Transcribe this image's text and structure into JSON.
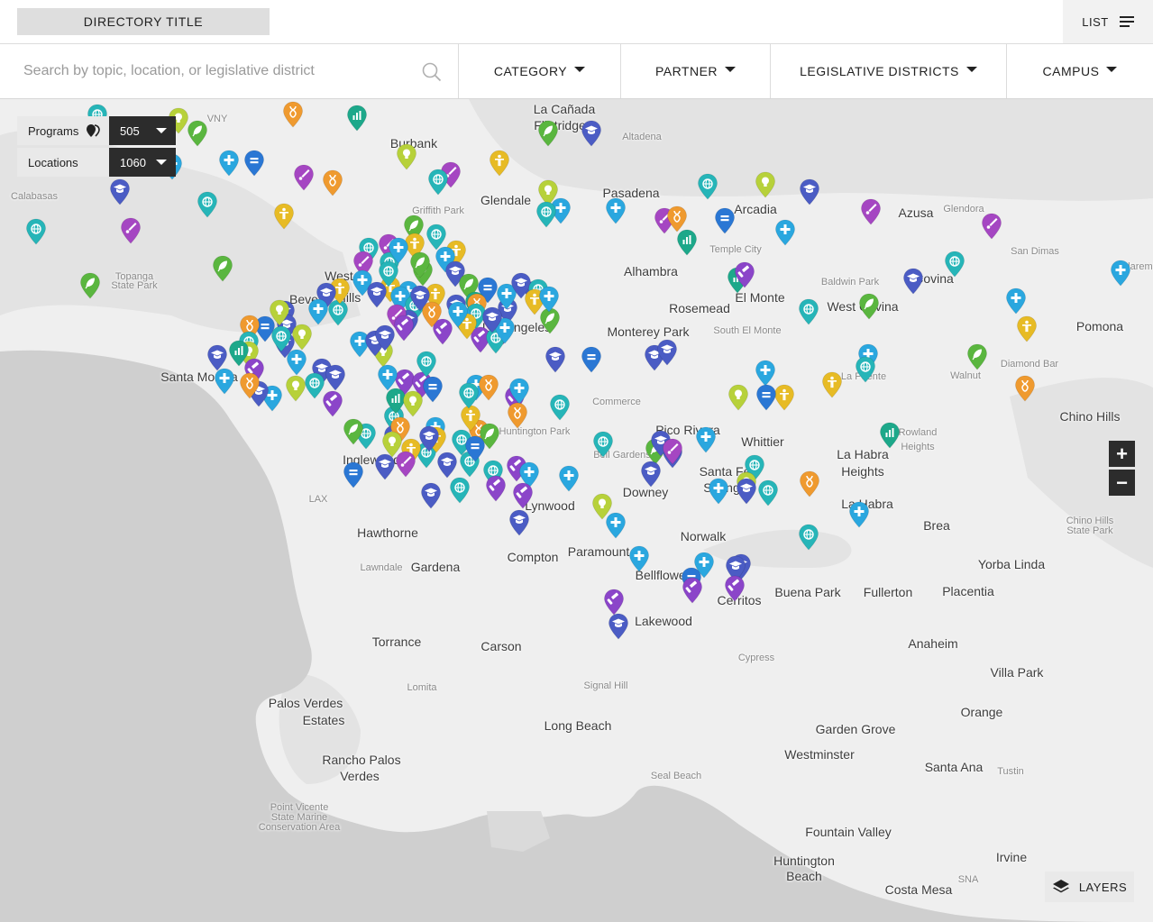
{
  "header": {
    "directory_title": "DIRECTORY TITLE",
    "list_label": "LIST"
  },
  "search": {
    "placeholder": "Search by topic, location, or legislative district"
  },
  "filters": [
    {
      "label": "CATEGORY"
    },
    {
      "label": "PARTNER"
    },
    {
      "label": "LEGISLATIVE DISTRICTS"
    },
    {
      "label": "CAMPUS"
    }
  ],
  "counters": {
    "programs": {
      "label": "Programs",
      "value": "505"
    },
    "locations": {
      "label": "Locations",
      "value": "1060"
    }
  },
  "map_controls": {
    "zoom_in": "+",
    "zoom_out": "−",
    "layers_label": "LAYERS"
  },
  "colors": {
    "water": "#cfcfcf",
    "land": "#efefef",
    "hills": "#e3e3e3",
    "dark_control": "#2c2c2c",
    "categories": {
      "health": "#2aa7df",
      "education": "#4b5cc4",
      "law": "#8b45c9",
      "arts": "#a546c2",
      "science": "#ef9a2f",
      "community": "#e7bb25",
      "ideas": "#b7d13a",
      "environment": "#5ab63f",
      "global": "#26b5b8",
      "data": "#1da88a",
      "government": "#2a77d4"
    }
  },
  "category_icons": {
    "health": "plus-icon",
    "education": "graduation-cap-icon",
    "law": "gavel-icon",
    "arts": "brush-icon",
    "science": "dna-icon",
    "community": "person-icon",
    "ideas": "lightbulb-icon",
    "environment": "leaf-icon",
    "global": "globe-icon",
    "data": "bar-chart-icon",
    "government": "equals-icon"
  },
  "place_labels": [
    {
      "text": "La Cañada",
      "cls": ""
    },
    {
      "text": "Flintridge",
      "cls": ""
    },
    {
      "text": "Altadena",
      "cls": "small"
    },
    {
      "text": "Burbank",
      "cls": ""
    },
    {
      "text": "VNY",
      "cls": "small"
    },
    {
      "text": "Glendale",
      "cls": ""
    },
    {
      "text": "Griffith Park",
      "cls": "small"
    },
    {
      "text": "Pasadena",
      "cls": ""
    },
    {
      "text": "Arcadia",
      "cls": ""
    },
    {
      "text": "Azusa",
      "cls": ""
    },
    {
      "text": "Glendora",
      "cls": "small"
    },
    {
      "text": "Calabasas",
      "cls": "small"
    },
    {
      "text": "San Dimas",
      "cls": "small"
    },
    {
      "text": "Temple City",
      "cls": "small"
    },
    {
      "text": "Topanga",
      "cls": "small"
    },
    {
      "text": "State Park",
      "cls": "small"
    },
    {
      "text": "Alhambra",
      "cls": ""
    },
    {
      "text": "Baldwin Park",
      "cls": "small"
    },
    {
      "text": "Covina",
      "cls": ""
    },
    {
      "text": "Claremo",
      "cls": "small"
    },
    {
      "text": "West",
      "cls": ""
    },
    {
      "text": "Hills",
      "cls": ""
    },
    {
      "text": "Beve",
      "cls": ""
    },
    {
      "text": "Rosemead",
      "cls": ""
    },
    {
      "text": "El Monte",
      "cls": ""
    },
    {
      "text": "West Covina",
      "cls": ""
    },
    {
      "text": "Pomona",
      "cls": ""
    },
    {
      "text": "Los Angeles",
      "cls": ""
    },
    {
      "text": "Monterey Park",
      "cls": ""
    },
    {
      "text": "South El Monte",
      "cls": "small"
    },
    {
      "text": "Diamond Bar",
      "cls": "small"
    },
    {
      "text": "Walnut",
      "cls": "small"
    },
    {
      "text": "Santa Monica",
      "cls": ""
    },
    {
      "text": "La Puente",
      "cls": "small"
    },
    {
      "text": "Chino Hills",
      "cls": ""
    },
    {
      "text": "Commerce",
      "cls": "small"
    },
    {
      "text": "Rowland",
      "cls": "small"
    },
    {
      "text": "Heights",
      "cls": "small"
    },
    {
      "text": "Huntington Park",
      "cls": "small"
    },
    {
      "text": "Pico Rivera",
      "cls": ""
    },
    {
      "text": "Whittier",
      "cls": ""
    },
    {
      "text": "La Habra",
      "cls": ""
    },
    {
      "text": "Heights",
      "cls": ""
    },
    {
      "text": "Inglewood",
      "cls": ""
    },
    {
      "text": "Bell Gardens",
      "cls": "small"
    },
    {
      "text": "Santa Fe",
      "cls": ""
    },
    {
      "text": "Springs",
      "cls": ""
    },
    {
      "text": "LAX",
      "cls": "small"
    },
    {
      "text": "Downey",
      "cls": ""
    },
    {
      "text": "La Habra",
      "cls": ""
    },
    {
      "text": "Lynwood",
      "cls": ""
    },
    {
      "text": "Hawthorne",
      "cls": ""
    },
    {
      "text": "Brea",
      "cls": ""
    },
    {
      "text": "Norwalk",
      "cls": ""
    },
    {
      "text": "Chino Hills",
      "cls": "small"
    },
    {
      "text": "State Park",
      "cls": "small"
    },
    {
      "text": "Paramount",
      "cls": ""
    },
    {
      "text": "Compton",
      "cls": ""
    },
    {
      "text": "Lawndale",
      "cls": "small"
    },
    {
      "text": "Gardena",
      "cls": ""
    },
    {
      "text": "Yorba Linda",
      "cls": ""
    },
    {
      "text": "Bellflower",
      "cls": ""
    },
    {
      "text": "Buena Park",
      "cls": ""
    },
    {
      "text": "Fullerton",
      "cls": ""
    },
    {
      "text": "Placentia",
      "cls": ""
    },
    {
      "text": "Cerritos",
      "cls": ""
    },
    {
      "text": "Lakewood",
      "cls": ""
    },
    {
      "text": "Anaheim",
      "cls": ""
    },
    {
      "text": "Torrance",
      "cls": ""
    },
    {
      "text": "Carson",
      "cls": ""
    },
    {
      "text": "Cypress",
      "cls": "small"
    },
    {
      "text": "Villa Park",
      "cls": ""
    },
    {
      "text": "Lomita",
      "cls": "small"
    },
    {
      "text": "Signal Hill",
      "cls": "small"
    },
    {
      "text": "Palos Verdes",
      "cls": ""
    },
    {
      "text": "Estates",
      "cls": ""
    },
    {
      "text": "Orange",
      "cls": ""
    },
    {
      "text": "Long Beach",
      "cls": ""
    },
    {
      "text": "Garden Grove",
      "cls": ""
    },
    {
      "text": "Westminster",
      "cls": ""
    },
    {
      "text": "Rancho Palos",
      "cls": ""
    },
    {
      "text": "Verdes",
      "cls": ""
    },
    {
      "text": "Santa Ana",
      "cls": ""
    },
    {
      "text": "Tustin",
      "cls": "small"
    },
    {
      "text": "Seal Beach",
      "cls": "small"
    },
    {
      "text": "Point Vicente",
      "cls": "small"
    },
    {
      "text": "State Marine",
      "cls": "small"
    },
    {
      "text": "Conservation Area",
      "cls": "small"
    },
    {
      "text": "Fountain Valley",
      "cls": ""
    },
    {
      "text": "Huntington",
      "cls": ""
    },
    {
      "text": "Beach",
      "cls": ""
    },
    {
      "text": "Irvine",
      "cls": ""
    },
    {
      "text": "SNA",
      "cls": "small"
    },
    {
      "text": "Costa Mesa",
      "cls": ""
    }
  ],
  "markers": [
    {
      "cat": "global"
    },
    {
      "cat": "ideas"
    },
    {
      "cat": "environment"
    },
    {
      "cat": "science"
    },
    {
      "cat": "data"
    },
    {
      "cat": "environment"
    },
    {
      "cat": "education"
    },
    {
      "cat": "health"
    },
    {
      "cat": "government"
    },
    {
      "cat": "health"
    },
    {
      "cat": "arts"
    },
    {
      "cat": "science"
    },
    {
      "cat": "ideas"
    },
    {
      "cat": "community"
    },
    {
      "cat": "arts"
    },
    {
      "cat": "global"
    },
    {
      "cat": "education"
    },
    {
      "cat": "global"
    },
    {
      "cat": "ideas"
    },
    {
      "cat": "health"
    },
    {
      "cat": "health"
    },
    {
      "cat": "global"
    },
    {
      "cat": "arts"
    },
    {
      "cat": "science"
    },
    {
      "cat": "government"
    },
    {
      "cat": "data"
    },
    {
      "cat": "ideas"
    },
    {
      "cat": "arts"
    },
    {
      "cat": "global"
    },
    {
      "cat": "arts"
    },
    {
      "cat": "education"
    },
    {
      "cat": "global"
    },
    {
      "cat": "environment"
    },
    {
      "cat": "arts"
    },
    {
      "cat": "environment"
    },
    {
      "cat": "environment"
    },
    {
      "cat": "community"
    },
    {
      "cat": "environment"
    },
    {
      "cat": "global"
    },
    {
      "cat": "community"
    },
    {
      "cat": "global"
    },
    {
      "cat": "arts"
    },
    {
      "cat": "community"
    },
    {
      "cat": "health"
    },
    {
      "cat": "global"
    },
    {
      "cat": "arts"
    },
    {
      "cat": "health"
    },
    {
      "cat": "environment"
    },
    {
      "cat": "education"
    },
    {
      "cat": "community"
    },
    {
      "cat": "health"
    },
    {
      "cat": "education"
    },
    {
      "cat": "environment"
    },
    {
      "cat": "community"
    },
    {
      "cat": "global"
    },
    {
      "cat": "health"
    },
    {
      "cat": "global"
    },
    {
      "cat": "education"
    },
    {
      "cat": "health"
    },
    {
      "cat": "global"
    },
    {
      "cat": "education"
    },
    {
      "cat": "community"
    },
    {
      "cat": "arts"
    },
    {
      "cat": "law"
    },
    {
      "cat": "education"
    },
    {
      "cat": "education"
    },
    {
      "cat": "government"
    },
    {
      "cat": "education"
    },
    {
      "cat": "education"
    },
    {
      "cat": "global"
    },
    {
      "cat": "ideas"
    },
    {
      "cat": "science"
    },
    {
      "cat": "ideas"
    },
    {
      "cat": "global"
    },
    {
      "cat": "health"
    },
    {
      "cat": "health"
    },
    {
      "cat": "education"
    },
    {
      "cat": "ideas"
    },
    {
      "cat": "data"
    },
    {
      "cat": "education"
    },
    {
      "cat": "law"
    },
    {
      "cat": "global"
    },
    {
      "cat": "health"
    },
    {
      "cat": "education"
    },
    {
      "cat": "health"
    },
    {
      "cat": "education"
    },
    {
      "cat": "ideas"
    },
    {
      "cat": "science"
    },
    {
      "cat": "law"
    },
    {
      "cat": "health"
    },
    {
      "cat": "ideas"
    },
    {
      "cat": "education"
    },
    {
      "cat": "education"
    },
    {
      "cat": "government"
    },
    {
      "cat": "health"
    },
    {
      "cat": "law"
    },
    {
      "cat": "education"
    },
    {
      "cat": "data"
    },
    {
      "cat": "education"
    },
    {
      "cat": "global"
    },
    {
      "cat": "environment"
    },
    {
      "cat": "community"
    },
    {
      "cat": "science"
    },
    {
      "cat": "global"
    },
    {
      "cat": "education"
    },
    {
      "cat": "health"
    },
    {
      "cat": "law"
    },
    {
      "cat": "arts"
    },
    {
      "cat": "global"
    },
    {
      "cat": "community"
    },
    {
      "cat": "health"
    },
    {
      "cat": "science"
    },
    {
      "cat": "education"
    },
    {
      "cat": "law"
    },
    {
      "cat": "law"
    },
    {
      "cat": "law"
    },
    {
      "cat": "government"
    },
    {
      "cat": "global"
    },
    {
      "cat": "global"
    },
    {
      "cat": "global"
    },
    {
      "cat": "global"
    },
    {
      "cat": "community"
    },
    {
      "cat": "arts"
    },
    {
      "cat": "education"
    },
    {
      "cat": "health"
    },
    {
      "cat": "science"
    },
    {
      "cat": "global"
    },
    {
      "cat": "community"
    },
    {
      "cat": "law"
    },
    {
      "cat": "health"
    },
    {
      "cat": "global"
    },
    {
      "cat": "science"
    },
    {
      "cat": "health"
    },
    {
      "cat": "science"
    },
    {
      "cat": "health"
    },
    {
      "cat": "education"
    },
    {
      "cat": "health"
    },
    {
      "cat": "data"
    },
    {
      "cat": "science"
    },
    {
      "cat": "ideas"
    },
    {
      "cat": "global"
    },
    {
      "cat": "environment"
    },
    {
      "cat": "education"
    },
    {
      "cat": "global"
    },
    {
      "cat": "global"
    },
    {
      "cat": "education"
    },
    {
      "cat": "law"
    },
    {
      "cat": "education"
    },
    {
      "cat": "government"
    },
    {
      "cat": "community"
    },
    {
      "cat": "ideas"
    },
    {
      "cat": "education"
    },
    {
      "cat": "environment"
    },
    {
      "cat": "government"
    },
    {
      "cat": "global"
    },
    {
      "cat": "health"
    },
    {
      "cat": "law"
    },
    {
      "cat": "law"
    },
    {
      "cat": "education"
    },
    {
      "cat": "health"
    },
    {
      "cat": "education"
    },
    {
      "cat": "government"
    },
    {
      "cat": "education"
    },
    {
      "cat": "education"
    },
    {
      "cat": "global"
    },
    {
      "cat": "environment"
    },
    {
      "cat": "education"
    },
    {
      "cat": "education"
    },
    {
      "cat": "education"
    },
    {
      "cat": "global"
    },
    {
      "cat": "health"
    },
    {
      "cat": "ideas"
    },
    {
      "cat": "arts"
    },
    {
      "cat": "health"
    },
    {
      "cat": "health"
    },
    {
      "cat": "global"
    },
    {
      "cat": "ideas"
    },
    {
      "cat": "health"
    },
    {
      "cat": "global"
    },
    {
      "cat": "community"
    },
    {
      "cat": "ideas"
    },
    {
      "cat": "science"
    },
    {
      "cat": "data"
    },
    {
      "cat": "law"
    },
    {
      "cat": "health"
    },
    {
      "cat": "community"
    },
    {
      "cat": "health"
    },
    {
      "cat": "global"
    },
    {
      "cat": "global"
    },
    {
      "cat": "health"
    },
    {
      "cat": "education"
    },
    {
      "cat": "government"
    },
    {
      "cat": "health"
    },
    {
      "cat": "community"
    },
    {
      "cat": "education"
    },
    {
      "cat": "global"
    },
    {
      "cat": "health"
    },
    {
      "cat": "environment"
    },
    {
      "cat": "science"
    },
    {
      "cat": "data"
    },
    {
      "cat": "environment"
    },
    {
      "cat": "health"
    },
    {
      "cat": "global"
    },
    {
      "cat": "education"
    },
    {
      "cat": "government"
    },
    {
      "cat": "health"
    },
    {
      "cat": "education"
    },
    {
      "cat": "law"
    },
    {
      "cat": "law"
    },
    {
      "cat": "health"
    },
    {
      "cat": "law"
    },
    {
      "cat": "education"
    }
  ]
}
